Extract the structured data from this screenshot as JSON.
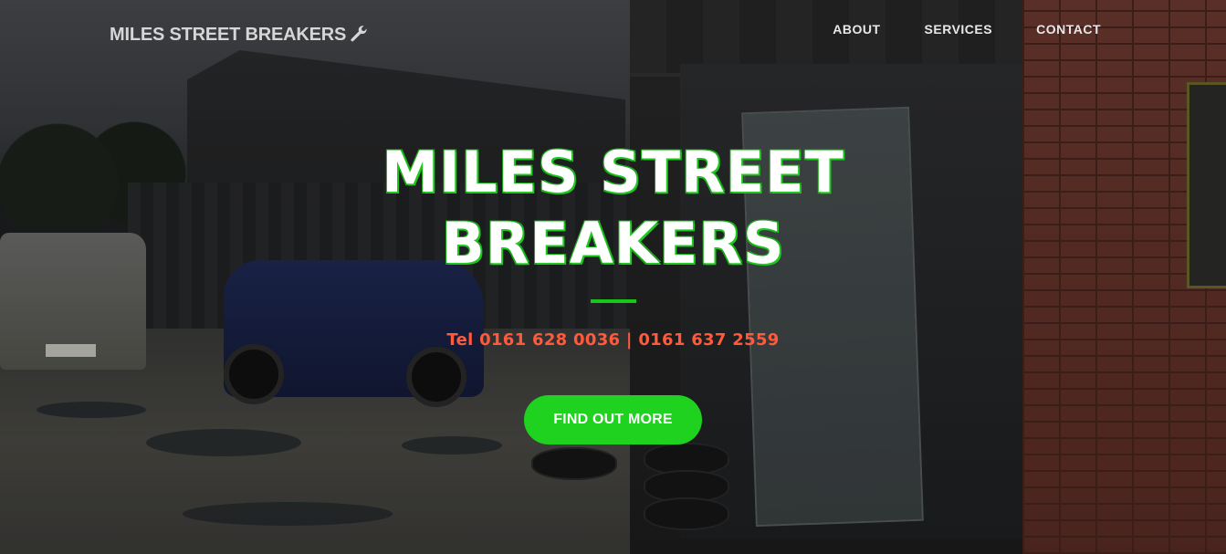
{
  "header": {
    "brand": "MILES STREET BREAKERS",
    "brand_icon": "wrench-icon",
    "nav": [
      {
        "label": "ABOUT"
      },
      {
        "label": "SERVICES"
      },
      {
        "label": "CONTACT"
      }
    ]
  },
  "hero": {
    "title": "MILES STREET BREAKERS",
    "phone": "Tel 0161 628 0036 | 0161 637 2559",
    "cta_label": "FIND OUT MORE",
    "colors": {
      "accent": "#1fd21f",
      "phone": "#ff5a3c",
      "title": "#ffffff"
    }
  }
}
